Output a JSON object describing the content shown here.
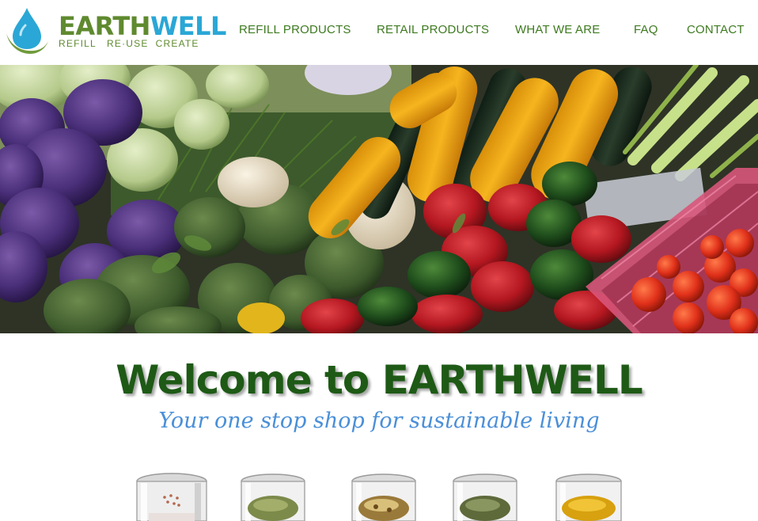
{
  "logo": {
    "word_part1": "EARTH",
    "word_part2": "WELL",
    "tagline": "REFILL   RE·USE  CREATE",
    "icon": "water-drop-icon",
    "colors": {
      "green": "#5f8a2f",
      "blue": "#2aa7d6"
    }
  },
  "nav": {
    "items": [
      {
        "label": "REFILL PRODUCTS"
      },
      {
        "label": "RETAIL PRODUCTS"
      },
      {
        "label": "WHAT WE ARE"
      },
      {
        "label": "FAQ"
      },
      {
        "label": "CONTACT"
      }
    ],
    "color": "#3d7a1f"
  },
  "hero": {
    "image": "vegetable market stall"
  },
  "welcome": {
    "title": "Welcome to EARTHWELL",
    "subtitle": "Your one stop shop for sustainable living",
    "title_color": "#1e5a16",
    "subtitle_color": "#4a8fd8"
  },
  "products": {
    "jars": [
      {
        "icon": "spice-jar-icon",
        "contents": "salt"
      },
      {
        "icon": "spice-jar-icon",
        "contents": "dried herbs"
      },
      {
        "icon": "spice-jar-icon",
        "contents": "flakes"
      },
      {
        "icon": "spice-jar-icon",
        "contents": "oregano"
      },
      {
        "icon": "spice-jar-icon",
        "contents": "turmeric"
      }
    ]
  }
}
